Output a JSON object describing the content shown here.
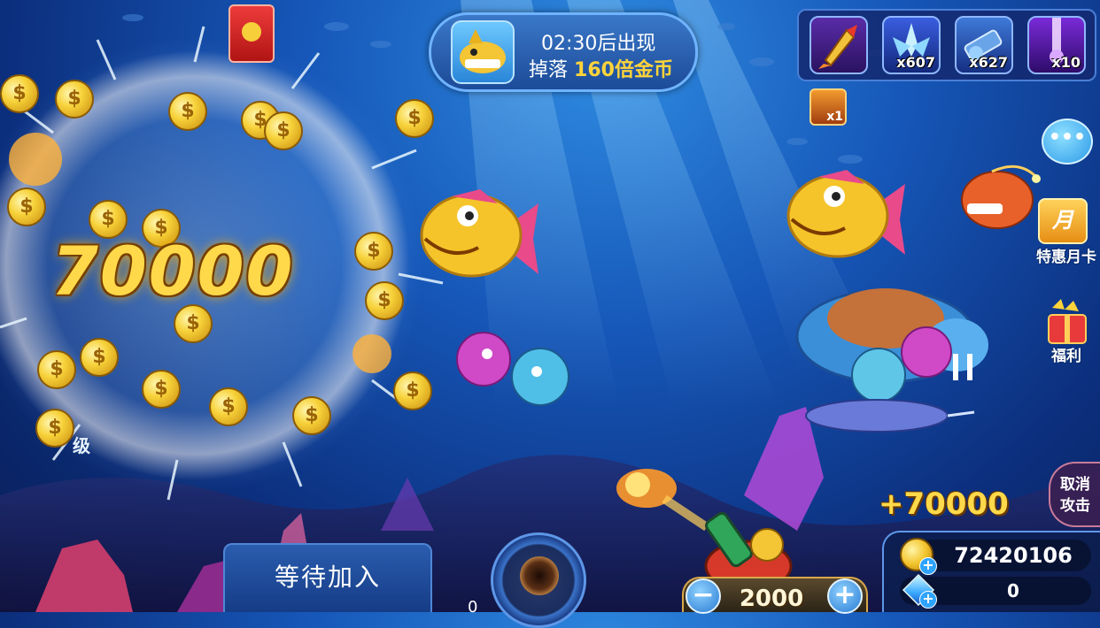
{
  "colors": {
    "ocean_top": "#2f8be0",
    "ocean_bottom": "#081d55",
    "gold_text": "#ffd94a",
    "banner_border": "#6fb3ff"
  },
  "effects": {
    "big_win_amount": "70000",
    "coin_symbol": "$",
    "level_label": "级"
  },
  "boss_banner": {
    "avatar_icon": "shark-boss-icon",
    "countdown": "02:30",
    "countdown_suffix": "后出现",
    "drop_prefix": "掉落",
    "drop_value": "160倍金币"
  },
  "skills": [
    {
      "name": "missile",
      "icon": "missile-icon",
      "count": ""
    },
    {
      "name": "freeze",
      "icon": "ice-crystal-icon",
      "count": "x607"
    },
    {
      "name": "lock",
      "icon": "lock-cannon-icon",
      "count": "x627"
    },
    {
      "name": "laser",
      "icon": "laser-beam-icon",
      "count": "x10"
    }
  ],
  "buff": {
    "icon": "buff-icon",
    "count": "x1"
  },
  "side_menu": {
    "chat_icon": "chat-bubble-icon",
    "monthly_card_icon_text": "月",
    "monthly_card_label": "特惠月卡",
    "welfare_label": "福利",
    "cancel_attack_line1": "取消",
    "cancel_attack_line2": "攻击"
  },
  "bottom": {
    "wait_join_label": "等待加入",
    "left_player_bet": "0",
    "bet_value": "2000",
    "minus_label": "−",
    "plus_label": "+",
    "win_popup": "+70000",
    "coin_balance": "72420106",
    "gem_balance": "0"
  }
}
